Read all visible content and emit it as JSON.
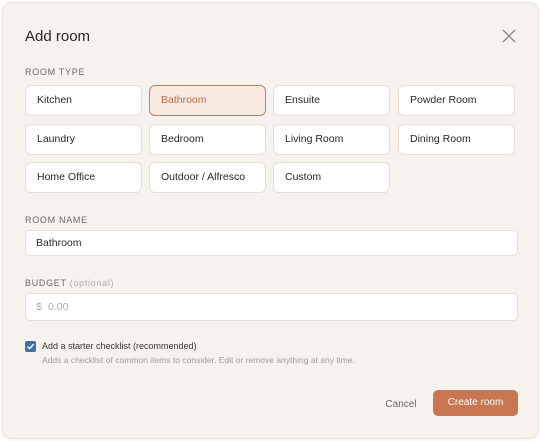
{
  "modal": {
    "title": "Add room",
    "close_icon": "close-icon"
  },
  "room_type": {
    "label": "ROOM TYPE",
    "selected": "Bathroom",
    "options": [
      "Kitchen",
      "Bathroom",
      "Ensuite",
      "Powder Room",
      "Laundry",
      "Bedroom",
      "Living Room",
      "Dining Room",
      "Home Office",
      "Outdoor / Alfresco",
      "Custom"
    ]
  },
  "room_name": {
    "label": "ROOM NAME",
    "value": "Bathroom"
  },
  "budget": {
    "label": "BUDGET",
    "optional": "(optional)",
    "currency": "$",
    "placeholder": "0.00"
  },
  "checklist": {
    "checked": true,
    "label": "Add a starter checklist (recommended)",
    "help": "Adds a checklist of common items to consider. Edit or remove anything at any time."
  },
  "footer": {
    "cancel_label": "Cancel",
    "create_label": "Create room"
  },
  "colors": {
    "accent": "#c97652",
    "checkbox": "#3e73a8",
    "background": "#f6f2ee"
  }
}
